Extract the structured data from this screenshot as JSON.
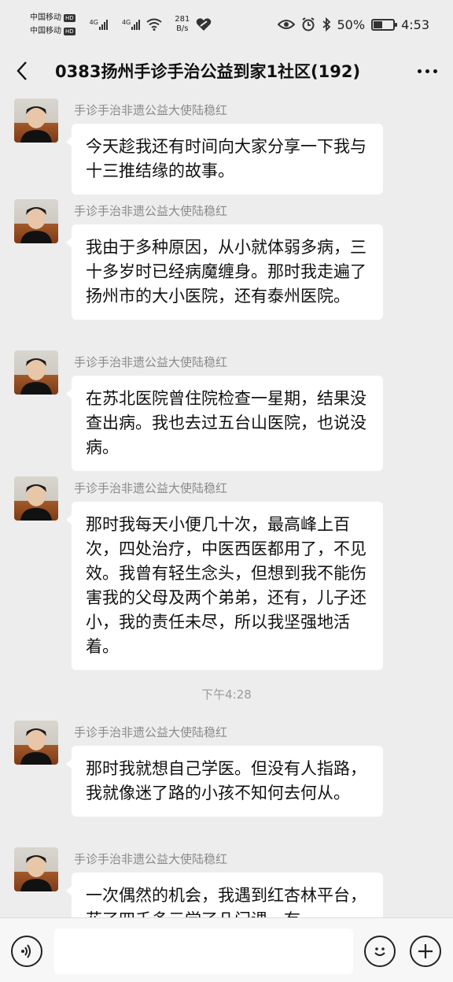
{
  "status_bar": {
    "carrier1": "中国移动",
    "carrier2": "中国移动",
    "hd_label": "HD",
    "signal_label": "4G",
    "net_speed_value": "281",
    "net_speed_unit": "B/s",
    "battery": "50%",
    "battery_level": 0.5,
    "time": "4:53"
  },
  "header": {
    "title": "0383扬州手诊手治公益到家1社区(192)"
  },
  "messages": [
    {
      "sender": "手诊手治非遗公益大使陆稳红",
      "text": "今天趁我还有时间向大家分享一下我与十三推结缘的故事。"
    },
    {
      "sender": "手诊手治非遗公益大使陆稳红",
      "text": "我由于多种原因，从小就体弱多病，三十多岁时已经病魔缠身。那时我走遍了扬州市的大小医院，还有泰州医院。"
    },
    {
      "sender": "手诊手治非遗公益大使陆稳红",
      "text": "在苏北医院曾住院检查一星期，结果没查出病。我也去过五台山医院，也说没病。"
    },
    {
      "sender": "手诊手治非遗公益大使陆稳红",
      "text": "那时我每天小便几十次，最高峰上百次，四处治疗，中医西医都用了，不见效。我曾有轻生念头，但想到我不能伤害我的父母及两个弟弟，还有，儿子还小，我的责任未尽，所以我坚强地活着。"
    },
    {
      "sender": "手诊手治非遗公益大使陆稳红",
      "text": "那时我就想自己学医。但没有人指路，我就像迷了路的小孩不知何去何从。"
    },
    {
      "sender": "手诊手治非遗公益大使陆稳红",
      "text": "一次偶然的机会，我遇到红杏林平台，花了四千多元学了几门课，有"
    }
  ],
  "timestamp": "下午4:28",
  "input": {
    "placeholder": ""
  },
  "icons": {
    "back": "chevron-left-icon",
    "more": "more-dots-icon",
    "voice": "voice-icon",
    "emoji": "emoji-icon",
    "plus": "plus-icon"
  }
}
